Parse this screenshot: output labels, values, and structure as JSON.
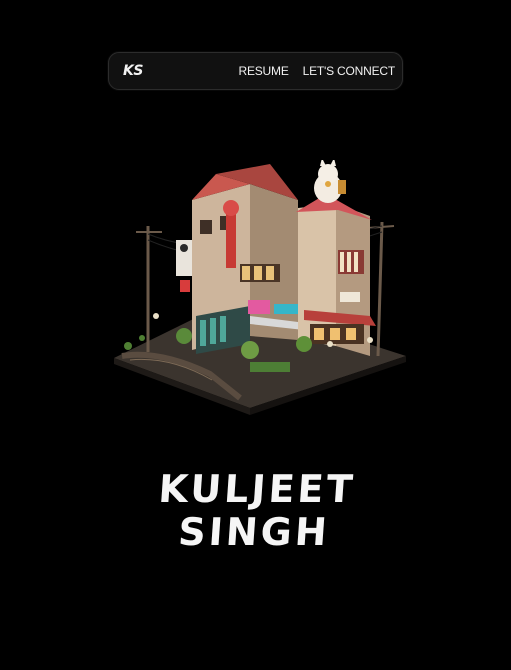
{
  "nav": {
    "logo": "KS",
    "links": [
      "RESUME",
      "LET'S CONNECT"
    ]
  },
  "hero": {
    "name_line1": "KULJEET",
    "name_line2": "SINGH",
    "illustration_icon": "isometric-japanese-street-building"
  },
  "colors": {
    "background": "#000000",
    "navbar_bg": "#111111",
    "text": "#f5f5f5"
  }
}
